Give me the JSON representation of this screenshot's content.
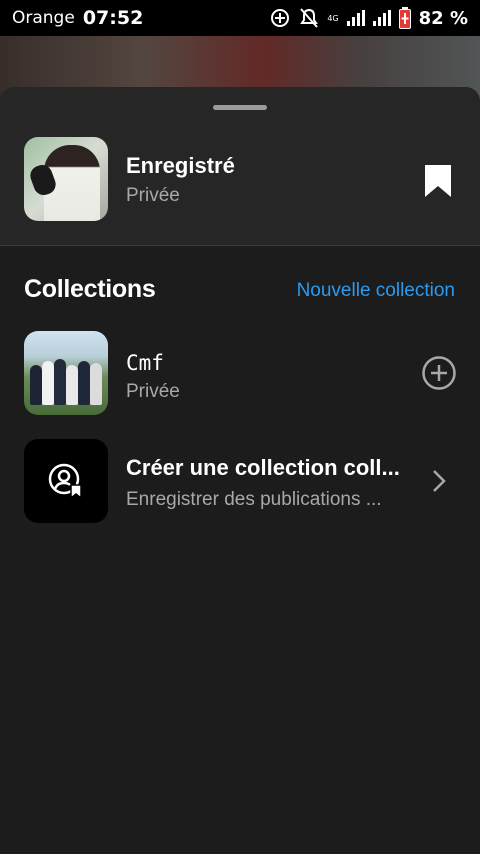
{
  "status_bar": {
    "carrier": "Orange",
    "time": "07:52",
    "network": "4G",
    "battery_percent": "82 %",
    "icons": [
      "data-saver-icon",
      "notifications-off-icon",
      "signal-icon",
      "signal-icon",
      "battery-charging-icon"
    ]
  },
  "saved": {
    "title": "Enregistré",
    "privacy": "Privée",
    "icon": "bookmark-icon"
  },
  "collections": {
    "heading": "Collections",
    "new_label": "Nouvelle collection",
    "items": [
      {
        "title": "Cmf",
        "privacy": "Privée",
        "action_icon": "add-circle-icon"
      },
      {
        "title": "Créer une collection coll...",
        "subtitle": "Enregistrer des publications ...",
        "action_icon": "chevron-right-icon"
      }
    ]
  },
  "colors": {
    "accent": "#2b9bf0",
    "sheet": "#262626",
    "background": "#1c1c1c"
  }
}
